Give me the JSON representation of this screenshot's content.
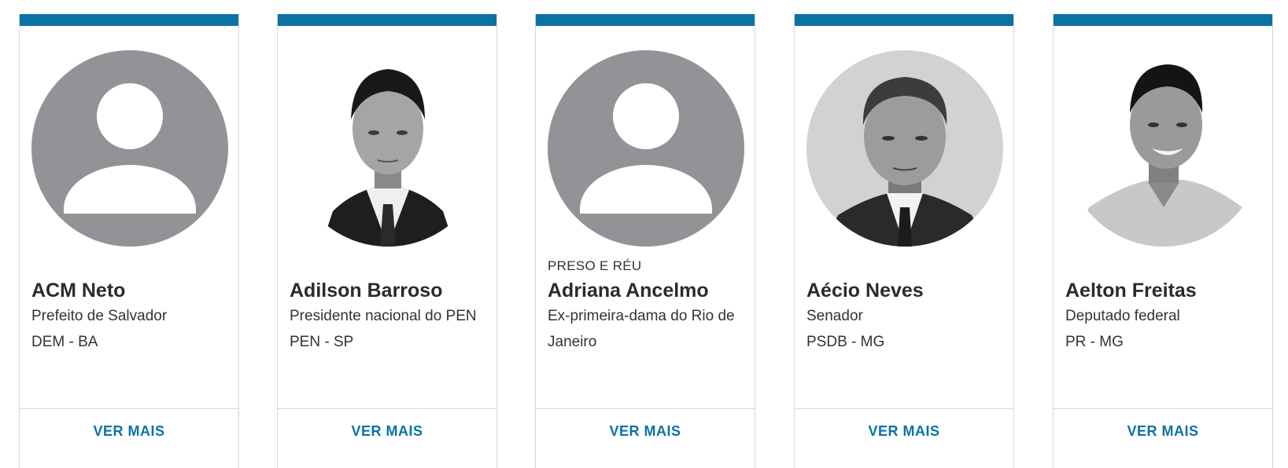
{
  "colors": {
    "accent": "#0b72a4",
    "placeholder_avatar": "#929396",
    "border": "#d6d6d6"
  },
  "cards": [
    {
      "avatar": "placeholder-person-icon",
      "tag": "",
      "name": "ACM Neto",
      "role": "Prefeito de Salvador",
      "party": "DEM - BA",
      "more_label": "VER MAIS"
    },
    {
      "avatar": "photo",
      "tag": "",
      "name": "Adilson Barroso",
      "role": "Presidente nacional do PEN",
      "party": "PEN - SP",
      "more_label": "VER MAIS"
    },
    {
      "avatar": "placeholder-person-icon",
      "tag": "PRESO E RÉU",
      "name": "Adriana Ancelmo",
      "role": "Ex-primeira-dama do Rio de Janeiro",
      "party": "",
      "more_label": "VER MAIS"
    },
    {
      "avatar": "photo",
      "tag": "",
      "name": "Aécio Neves",
      "role": "Senador",
      "party": "PSDB - MG",
      "more_label": "VER MAIS"
    },
    {
      "avatar": "photo",
      "tag": "",
      "name": "Aelton Freitas",
      "role": "Deputado federal",
      "party": "PR - MG",
      "more_label": "VER MAIS"
    }
  ]
}
